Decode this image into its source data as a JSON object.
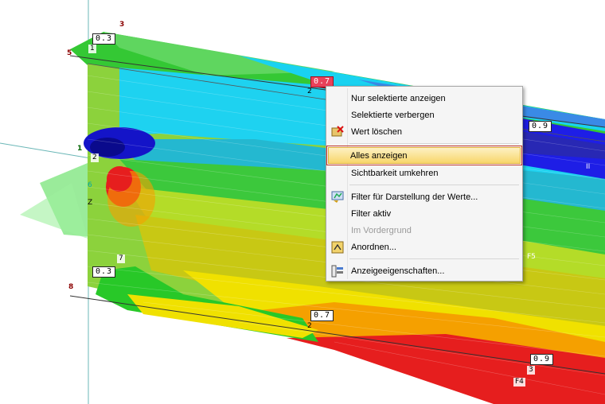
{
  "value_labels": [
    "0.3",
    "0.7",
    "0.9",
    "0.3",
    "0.7",
    "0.9"
  ],
  "node_tags": [
    "3",
    "5",
    "1",
    "1",
    "2",
    "6",
    "Z",
    "7",
    "8",
    "F5",
    "F4",
    "3",
    "2",
    "2",
    "II"
  ],
  "context_menu": {
    "items": [
      {
        "label": "Nur selektierte anzeigen",
        "icon": "",
        "disabled": false
      },
      {
        "label": "Selektierte verbergen",
        "icon": "",
        "disabled": false
      },
      {
        "label": "Wert löschen",
        "icon": "delete-value-icon",
        "disabled": false
      },
      {
        "label": "Alles anzeigen",
        "icon": "",
        "disabled": false,
        "highlighted": true
      },
      {
        "label": "Sichtbarkeit umkehren",
        "icon": "",
        "disabled": false
      },
      {
        "label": "Filter für Darstellung der Werte...",
        "icon": "filter-icon",
        "disabled": false
      },
      {
        "label": "Filter aktiv",
        "icon": "",
        "disabled": false
      },
      {
        "label": "Im Vordergrund",
        "icon": "",
        "disabled": true
      },
      {
        "label": "Anordnen...",
        "icon": "arrange-icon",
        "disabled": false
      },
      {
        "label": "Anzeigeeigenschaften...",
        "icon": "display-properties-icon",
        "disabled": false
      }
    ]
  },
  "colors": {
    "blue": "#1414c8",
    "cyan": "#19d2f0",
    "light_blue": "#3cb4f0",
    "green": "#28c828",
    "light_green": "#7ce62a",
    "yellow": "#f0e100",
    "olive": "#c8c814",
    "orange": "#f5a000",
    "red": "#e61e1e"
  }
}
